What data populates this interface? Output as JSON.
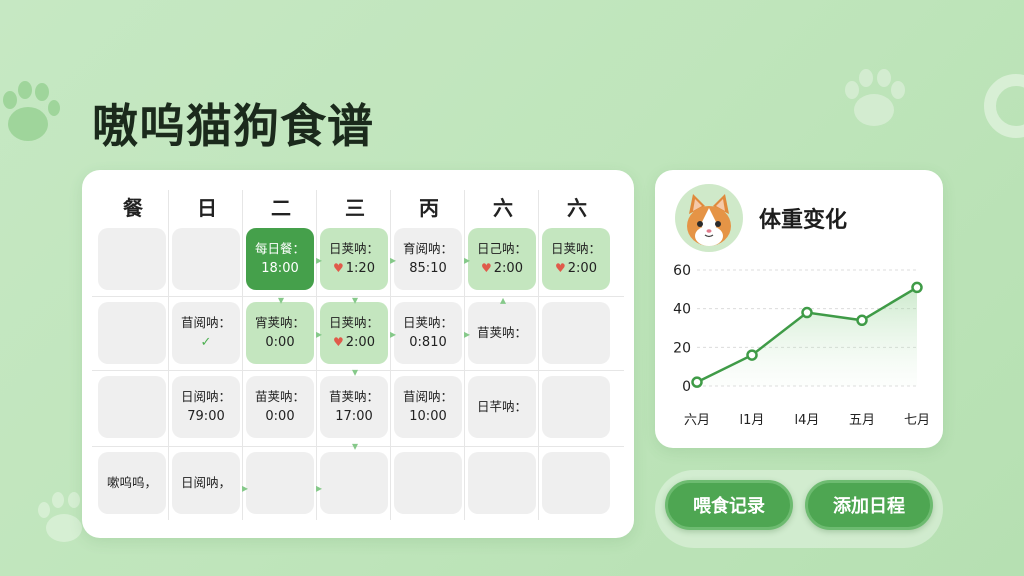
{
  "app": {
    "title": "嗷呜猫狗食谱"
  },
  "schedule": {
    "days": [
      "餐",
      "日",
      "二",
      "三",
      "丙",
      "六",
      "六"
    ],
    "cells": [
      [
        {
          "l1": "",
          "l2": "",
          "style": "empty"
        },
        {
          "l1": "",
          "l2": "",
          "style": "empty"
        },
        {
          "l1": "每日餐：",
          "l2": "18:00",
          "style": "dark"
        },
        {
          "l1": "日荚呐：",
          "l2": "1:20",
          "heart": true,
          "style": "light"
        },
        {
          "l1": "育阅呐：",
          "l2": "85:10",
          "style": "empty"
        },
        {
          "l1": "日己呐：",
          "l2": "2:00",
          "heart": true,
          "style": "light"
        },
        {
          "l1": "日荚呐：",
          "l2": "2:00",
          "heart": true,
          "style": "light"
        }
      ],
      [
        {
          "l1": "",
          "l2": "",
          "style": "empty"
        },
        {
          "l1": "苜阅呐：",
          "l2": "✓",
          "check": true,
          "style": "empty"
        },
        {
          "l1": "宵荚呐：",
          "l2": "0:00",
          "style": "light"
        },
        {
          "l1": "日荚呐：",
          "l2": "2:00",
          "heart": true,
          "style": "light"
        },
        {
          "l1": "日荚呐：",
          "l2": "0:810",
          "style": "empty"
        },
        {
          "l1": "苜荚呐：",
          "l2": "",
          "style": "empty"
        },
        {
          "l1": "",
          "l2": "",
          "style": "empty"
        }
      ],
      [
        {
          "l1": "",
          "l2": "",
          "style": "empty"
        },
        {
          "l1": "日阅呐：",
          "l2": "79:00",
          "style": "empty"
        },
        {
          "l1": "苗荚呐：",
          "l2": "0:00",
          "style": "empty"
        },
        {
          "l1": "苜荚呐：",
          "l2": "17:00",
          "style": "empty"
        },
        {
          "l1": "苜阅呐：",
          "l2": "10:00",
          "style": "empty"
        },
        {
          "l1": "日芊呐：",
          "l2": "",
          "style": "empty"
        },
        {
          "l1": "",
          "l2": "",
          "style": "empty"
        }
      ],
      [
        {
          "l1": "嗽呜呜，",
          "l2": "",
          "style": "empty"
        },
        {
          "l1": "日阅呐，",
          "l2": "",
          "style": "empty"
        },
        {
          "l1": "",
          "l2": "",
          "style": "empty"
        },
        {
          "l1": "",
          "l2": "",
          "style": "empty"
        },
        {
          "l1": "",
          "l2": "",
          "style": "empty"
        },
        {
          "l1": "",
          "l2": "",
          "style": "empty"
        },
        {
          "l1": "",
          "l2": "",
          "style": "empty"
        }
      ]
    ]
  },
  "weight": {
    "title": "体重变化",
    "accent": "#3f9b47"
  },
  "chart_data": {
    "type": "area",
    "title": "体重变化",
    "x": [
      "六月",
      "l1月",
      "l4月",
      "五月",
      "七月"
    ],
    "y_ticks": [
      0,
      20,
      40,
      60
    ],
    "ylim": [
      0,
      60
    ],
    "series": [
      {
        "values": [
          2,
          16,
          38,
          34,
          51
        ]
      }
    ],
    "grid": true
  },
  "buttons": {
    "feed_log": "喂食记录",
    "add_schedule": "添加日程"
  }
}
